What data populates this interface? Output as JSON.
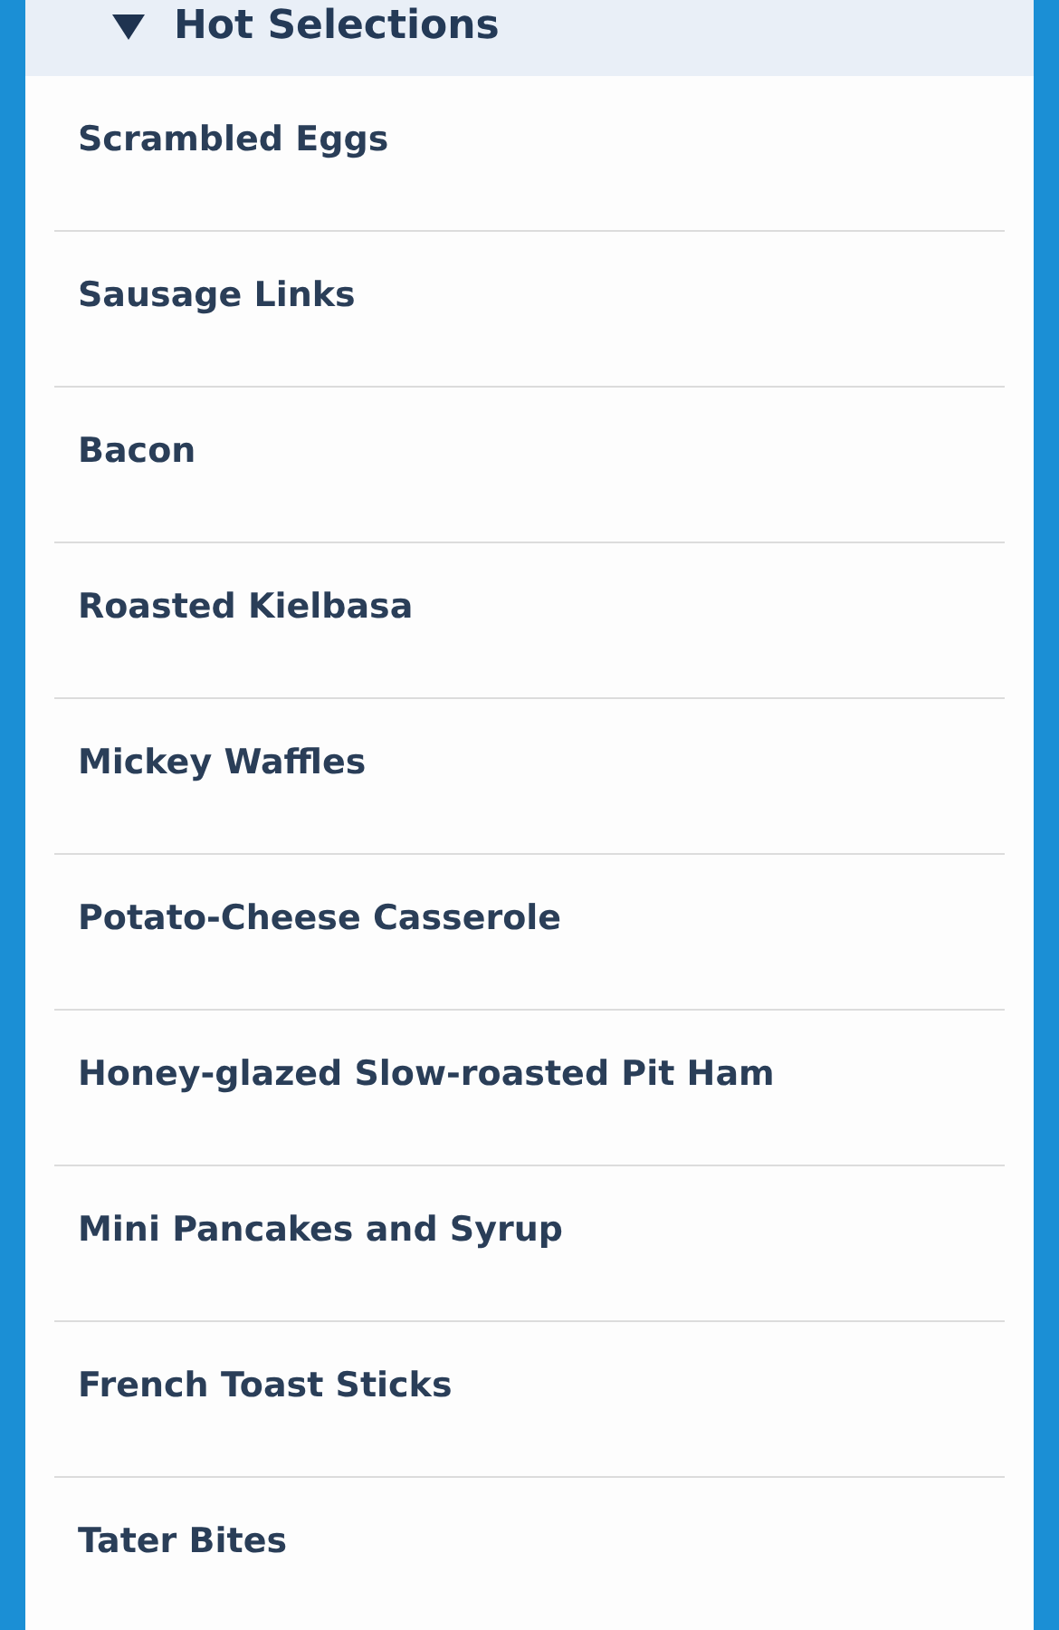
{
  "section": {
    "title": "Hot Selections",
    "expanded": true
  },
  "items": [
    "Scrambled Eggs",
    "Sausage Links",
    "Bacon",
    "Roasted Kielbasa",
    "Mickey Waffles",
    "Potato-Cheese Casserole",
    "Honey-glazed Slow-roasted Pit Ham",
    "Mini Pancakes and Syrup",
    "French Toast Sticks",
    "Tater Bites"
  ]
}
